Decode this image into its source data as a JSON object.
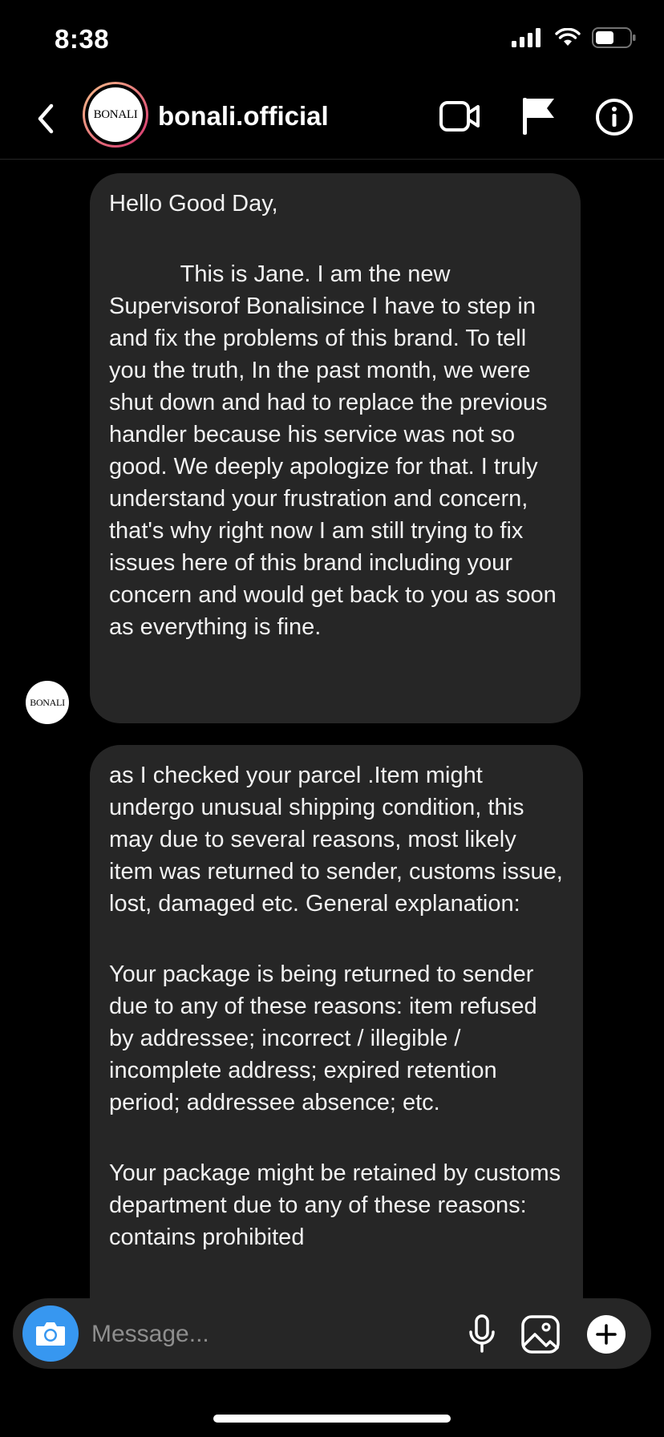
{
  "status_bar": {
    "time": "8:38"
  },
  "header": {
    "username": "bonali.official",
    "avatar_text": "BONALI"
  },
  "messages": [
    {
      "paragraphs": [
        "Hello Good Day,",
        "           This is Jane. I am the new Supervisorof Bonalisince I have to step in and fix the problems of this brand. To tell you the truth, In the past month, we were shut down and had to replace the previous handler because his service was not so good. We deeply apologize for that. I truly understand your frustration and concern, that's why right now I am still trying to fix issues here of this brand including your concern and would get back to you as soon as everything is fine."
      ]
    },
    {
      "paragraphs": [
        "as I checked your parcel .Item might undergo unusual shipping condition, this may due to several reasons, most likely item was returned to sender, customs issue, lost, damaged etc. General explanation:",
        "Your package is being returned to sender due to any of these reasons: item refused by addressee; incorrect / illegible / incomplete address; expired retention period; addressee absence; etc.",
        "Your package might be retained by customs department due to any of these reasons: contains prohibited"
      ]
    }
  ],
  "composer": {
    "placeholder": "Message..."
  },
  "icons": {
    "back": "chevron-left-icon",
    "video": "video-camera-icon",
    "flag": "flag-icon",
    "info": "info-icon",
    "camera": "camera-icon",
    "mic": "microphone-icon",
    "gallery": "gallery-icon",
    "add": "plus-icon"
  },
  "colors": {
    "background": "#000000",
    "bubble": "#262626",
    "accent": "#3797f0"
  }
}
